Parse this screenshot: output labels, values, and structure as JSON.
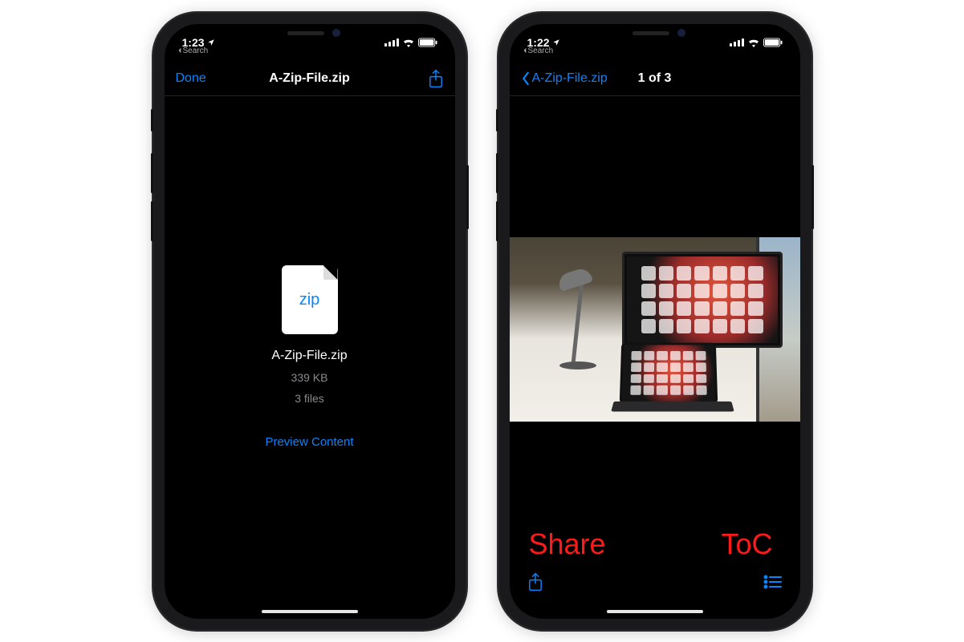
{
  "left": {
    "status": {
      "time": "1:23",
      "backApp": "Search"
    },
    "nav": {
      "done": "Done",
      "title": "A-Zip-File.zip"
    },
    "file": {
      "iconLabel": "zip",
      "name": "A-Zip-File.zip",
      "size": "339 KB",
      "count": "3 files",
      "previewLink": "Preview Content"
    }
  },
  "right": {
    "status": {
      "time": "1:22",
      "backApp": "Search"
    },
    "nav": {
      "backLabel": "A-Zip-File.zip",
      "title": "1 of 3"
    },
    "annotations": {
      "share": "Share",
      "toc": "ToC"
    }
  }
}
